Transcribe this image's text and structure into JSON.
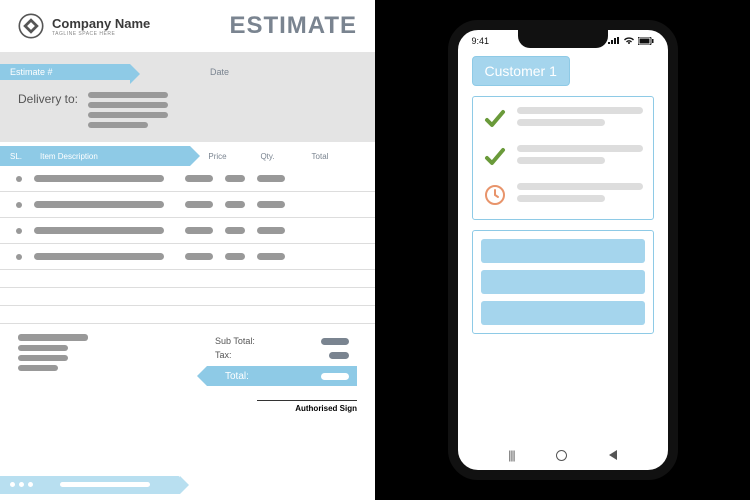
{
  "doc": {
    "company_name": "Company Name",
    "tagline": "TAGLINE SPACE HERE",
    "title": "ESTIMATE",
    "estimate_label": "Estimate #",
    "date_label": "Date",
    "delivery_label": "Delivery to:",
    "columns": {
      "sl": "SL.",
      "desc": "Item Description",
      "price": "Price",
      "qty": "Qty.",
      "total": "Total"
    },
    "subtotal_label": "Sub Total:",
    "tax_label": "Tax:",
    "total_label": "Total:",
    "sign_label": "Authorised Sign"
  },
  "phone": {
    "time": "9:41",
    "customer": "Customer 1"
  }
}
